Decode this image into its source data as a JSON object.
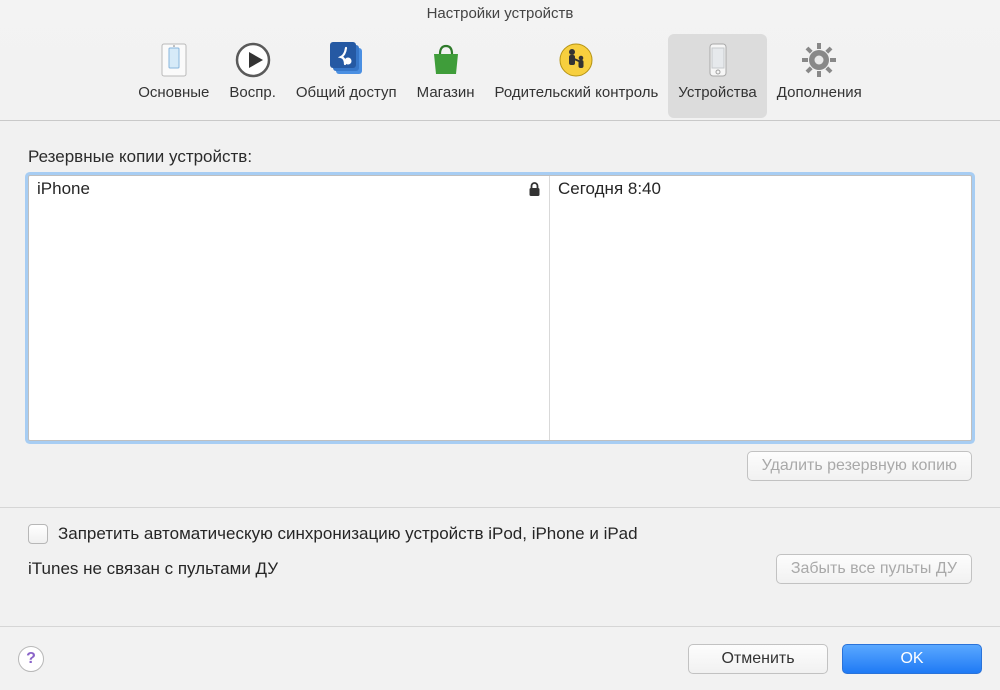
{
  "window": {
    "title": "Настройки устройств"
  },
  "toolbar": {
    "items": [
      {
        "id": "general",
        "label": "Основные"
      },
      {
        "id": "playback",
        "label": "Воспр."
      },
      {
        "id": "sharing",
        "label": "Общий доступ"
      },
      {
        "id": "store",
        "label": "Магазин"
      },
      {
        "id": "parental",
        "label": "Родительский контроль"
      },
      {
        "id": "devices",
        "label": "Устройства",
        "selected": true
      },
      {
        "id": "advanced",
        "label": "Дополнения"
      }
    ]
  },
  "devices": {
    "section_label": "Резервные копии устройств:",
    "backups": [
      {
        "name": "iPhone",
        "encrypted": true,
        "date": "Сегодня 8:40"
      }
    ],
    "delete_button": "Удалить резервную копию",
    "delete_enabled": false,
    "prevent_sync_checkbox": "Запретить автоматическую синхронизацию устройств iPod, iPhone и iPad",
    "prevent_sync_checked": false,
    "remote_status": "iTunes не связан с пультами ДУ",
    "forget_remotes_button": "Забыть все пульты ДУ",
    "forget_remotes_enabled": false
  },
  "footer": {
    "cancel": "Отменить",
    "ok": "OK"
  }
}
